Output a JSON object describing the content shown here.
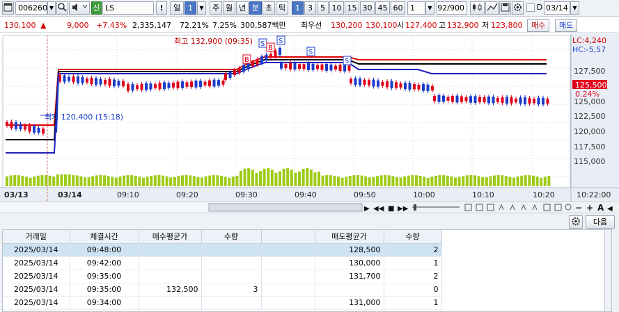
{
  "toolbar": {
    "code": "006260",
    "search_icon": "search-icon",
    "stock_badge": "신",
    "stock_name": "LS",
    "alert": "!",
    "period_labels": [
      "일",
      "주",
      "월",
      "년",
      "분",
      "초",
      "틱"
    ],
    "period_selected_value": "1",
    "interval_options": [
      "1",
      "3",
      "5",
      "10",
      "15",
      "30",
      "45",
      "60"
    ],
    "interval_selected": "1",
    "count_value": "1",
    "bar_count": "92/900",
    "date_checkbox_label": "D",
    "date_value": "03/14"
  },
  "pricerow": {
    "price": "130,100",
    "change_arrow": "▲",
    "change": "9,000",
    "change_pct": "+7.43%",
    "volume": "2,335,147",
    "pct2": "72.21%",
    "pct3": "7.25%",
    "amount": "300,587백만",
    "best_label": "최우선",
    "best_ask": "130,200",
    "best_bid": "130,100",
    "open_label": "시",
    "open": "127,400",
    "high_label": "고",
    "high": "132,900",
    "low_label": "저",
    "low": "123,800",
    "buy_button": "매수",
    "sell_button": "매도"
  },
  "chart": {
    "lc_label": "LC:4,240",
    "hc_label": "HC:-5,57",
    "high_annotation": "최고 132,900 (09:35)",
    "low_annotation": "최저 120,400 (15:18)",
    "current_price": "125,500",
    "current_pct": "0.24%",
    "y_tick_labels": [
      "127,500",
      "125,000",
      "122,500",
      "120,000",
      "117,500",
      "115,000"
    ],
    "x_date_labels": [
      "03/13",
      "03/14"
    ],
    "x_tick_labels": [
      "09:10",
      "09:20",
      "09:30",
      "09:40",
      "09:50",
      "10:00",
      "10:10",
      "10:20"
    ],
    "x_end_label": "10:22:00",
    "colors": {
      "up": "#e0001a",
      "down": "#1a3ccc",
      "volume": "#9ccb19",
      "band_red": "#e00000",
      "band_black": "#000000",
      "band_blue": "#1d1dbb"
    }
  },
  "chart_data": {
    "type": "candlestick",
    "title": "",
    "xlabel": "",
    "ylabel": "",
    "ylim": [
      113500,
      134500
    ],
    "annotations": [
      {
        "label": "최고",
        "value": 132900,
        "time": "09:35"
      },
      {
        "label": "최저",
        "value": 120400,
        "time": "15:18"
      }
    ],
    "signals": [
      "S",
      "S",
      "S",
      "B",
      "B",
      "S"
    ],
    "prev_day_close_approx": 121100,
    "current": {
      "value": 125500,
      "pct": "0.24%"
    }
  },
  "scroll": {
    "controls": [
      "◀",
      "▶",
      "◀◀",
      "■",
      "▶▶",
      "−",
      "+",
      "A"
    ]
  },
  "bottom": {
    "next_button": "다음",
    "columns": [
      "거래일",
      "체결시간",
      "매수평균가",
      "수량",
      "",
      "매도평균가",
      "수량"
    ],
    "rows": [
      [
        "2025/03/14",
        "09:48:00",
        "",
        "",
        "",
        "128,500",
        "2"
      ],
      [
        "2025/03/14",
        "09:42:00",
        "",
        "",
        "",
        "130,000",
        "1"
      ],
      [
        "2025/03/14",
        "09:35:00",
        "",
        "",
        "",
        "131,700",
        "2"
      ],
      [
        "2025/03/14",
        "09:35:00",
        "132,500",
        "3",
        "",
        "",
        "0"
      ],
      [
        "2025/03/14",
        "09:34:00",
        "",
        "",
        "",
        "131,000",
        "1"
      ]
    ]
  }
}
